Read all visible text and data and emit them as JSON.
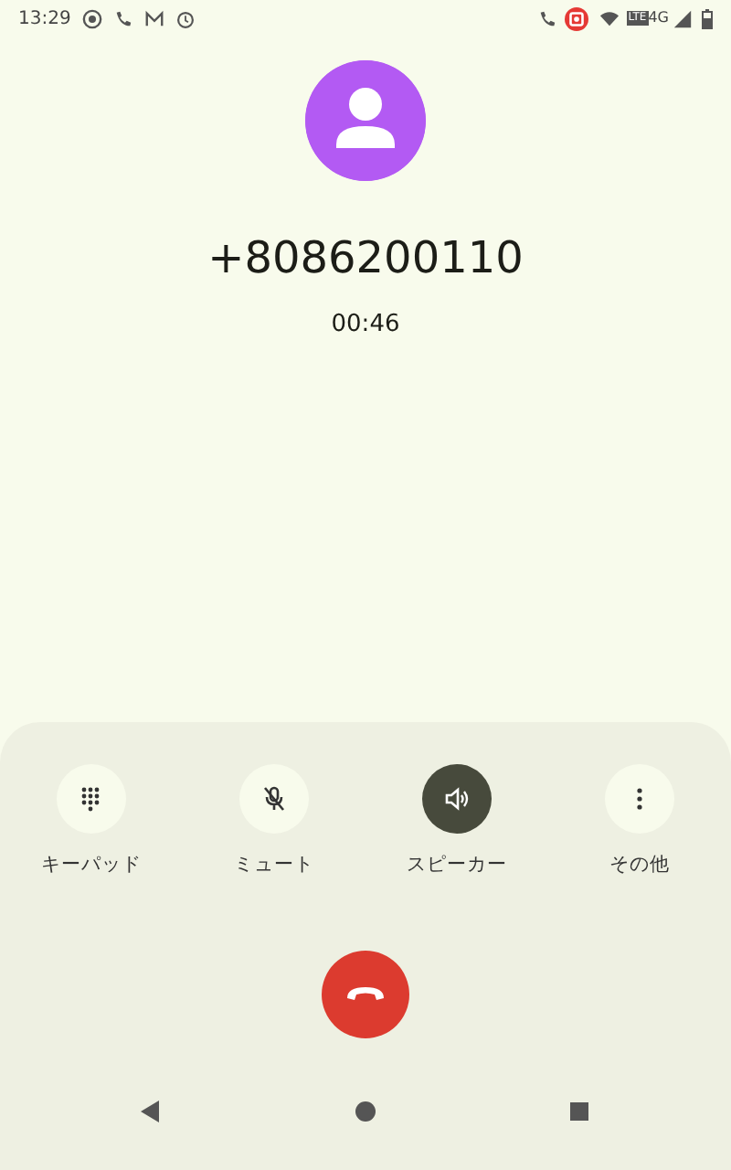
{
  "status_bar": {
    "time": "13:29",
    "network_badge": "LTE",
    "network": "4G"
  },
  "call": {
    "number": "+8086200110",
    "duration": "00:46"
  },
  "controls": [
    {
      "kind": "keypad",
      "label": "キーパッド",
      "on": false
    },
    {
      "kind": "mute",
      "label": "ミュート",
      "on": false
    },
    {
      "kind": "speaker",
      "label": "スピーカー",
      "on": true
    },
    {
      "kind": "more",
      "label": "その他",
      "on": false
    }
  ]
}
